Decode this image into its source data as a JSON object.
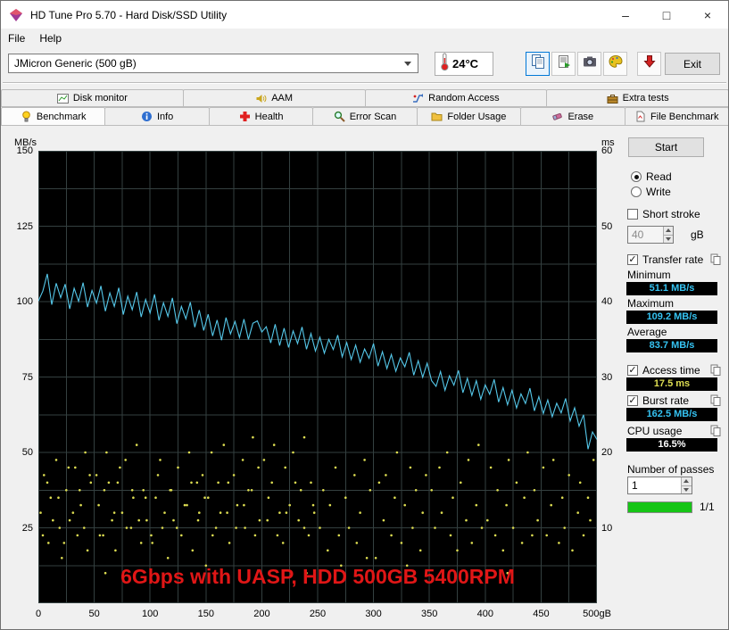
{
  "window": {
    "title": "HD Tune Pro 5.70 - Hard Disk/SSD Utility",
    "controls": {
      "minimize": "–",
      "maximize": "□",
      "close": "×"
    }
  },
  "menu": {
    "file": "File",
    "help": "Help"
  },
  "toolbar": {
    "drive_select": "JMicron Generic (500 gB)",
    "temperature": "24°C",
    "exit_label": "Exit"
  },
  "tabs": {
    "row1": [
      "Disk monitor",
      "AAM",
      "Random Access",
      "Extra tests"
    ],
    "row2": [
      "Benchmark",
      "Info",
      "Health",
      "Error Scan",
      "Folder Usage",
      "Erase",
      "File Benchmark"
    ],
    "active": "Benchmark"
  },
  "panel": {
    "start_label": "Start",
    "read_label": "Read",
    "write_label": "Write",
    "short_stroke_label": "Short stroke",
    "short_stroke_value": "40",
    "short_stroke_unit": "gB",
    "transfer_rate_label": "Transfer rate",
    "minimum_label": "Minimum",
    "minimum_value": "51.1 MB/s",
    "maximum_label": "Maximum",
    "maximum_value": "109.2 MB/s",
    "average_label": "Average",
    "average_value": "83.7 MB/s",
    "access_time_label": "Access time",
    "access_time_value": "17.5 ms",
    "burst_rate_label": "Burst rate",
    "burst_rate_value": "162.5 MB/s",
    "cpu_usage_label": "CPU usage",
    "cpu_usage_value": "16.5%",
    "passes_label": "Number of passes",
    "passes_value": "1",
    "progress_label": "1/1"
  },
  "icons": {
    "checkmark": "✓"
  },
  "chart_data": {
    "type": "line",
    "x_unit": "gB",
    "x_range": [
      0,
      500
    ],
    "x_ticks": [
      0,
      50,
      100,
      150,
      200,
      250,
      300,
      350,
      400,
      450,
      500
    ],
    "x_tick_labels": [
      "0",
      "50",
      "100",
      "150",
      "200",
      "250",
      "300",
      "350",
      "400",
      "450",
      "500gB"
    ],
    "y_left": {
      "unit": "MB/s",
      "range": [
        0,
        150
      ],
      "ticks": [
        150,
        125,
        100,
        75,
        50,
        25
      ]
    },
    "y_right": {
      "unit": "ms",
      "range": [
        0,
        60
      ],
      "ticks": [
        60,
        50,
        40,
        30,
        20,
        10
      ]
    },
    "grid": {
      "color": "#344040",
      "x_step": 25,
      "y_step": 12.5
    },
    "stats": {
      "minimum_mbs": 51.1,
      "maximum_mbs": 109.2,
      "average_mbs": 83.7,
      "access_time_ms": 17.5,
      "burst_rate_mbs": 162.5,
      "cpu_usage_pct": 16.5
    },
    "annotation": {
      "text": "6Gbps with UASP, HDD 500GB 5400RPM",
      "color": "#e01616"
    },
    "series": [
      {
        "name": "transfer_rate",
        "type": "line",
        "color": "#55c8ea",
        "axis": "left",
        "x_start": 0,
        "x_step": 4,
        "values": [
          100.2,
          103.5,
          109.2,
          99.0,
          106.1,
          101.3,
          105.8,
          97.6,
          104.4,
          100.1,
          106.3,
          98.2,
          103.7,
          99.5,
          105.2,
          96.8,
          102.9,
          98.4,
          104.6,
          95.7,
          101.8,
          97.3,
          103.2,
          94.9,
          100.7,
          96.2,
          102.4,
          93.8,
          99.6,
          95.1,
          101.2,
          92.7,
          98.4,
          94.3,
          99.8,
          91.5,
          97.2,
          90.4,
          95.8,
          88.6,
          93.9,
          87.2,
          94.7,
          89.3,
          93.4,
          88.1,
          94.2,
          87.5,
          92.8,
          93.6,
          89.9,
          91.7,
          86.3,
          92.5,
          85.4,
          91.2,
          84.8,
          90.3,
          86.1,
          91.6,
          84.2,
          89.4,
          83.6,
          88.2,
          82.9,
          87.5,
          84.1,
          88.9,
          81.7,
          86.4,
          80.8,
          85.6,
          79.9,
          84.3,
          81.2,
          86.1,
          78.6,
          83.4,
          77.8,
          82.5,
          76.9,
          81.3,
          78.4,
          83.2,
          75.6,
          80.4,
          74.9,
          79.6,
          73.8,
          71.9,
          76.8,
          70.6,
          75.4,
          72.3,
          77.2,
          69.8,
          74.6,
          68.9,
          73.8,
          67.6,
          72.4,
          69.3,
          74.2,
          66.7,
          71.5,
          65.8,
          70.6,
          64.7,
          69.4,
          66.2,
          71.3,
          63.8,
          68.5,
          62.9,
          67.4,
          61.8,
          66.3,
          63.1,
          67.9,
          60.4,
          64.8,
          58.7,
          62.5,
          51.1,
          56.8,
          54.3
        ]
      },
      {
        "name": "access_time",
        "type": "scatter",
        "color": "#dede52",
        "axis": "right",
        "points": [
          [
            2,
            12
          ],
          [
            5,
            17
          ],
          [
            9,
            8
          ],
          [
            11,
            14
          ],
          [
            16,
            19
          ],
          [
            19,
            10
          ],
          [
            21,
            6
          ],
          [
            25,
            15
          ],
          [
            28,
            11
          ],
          [
            33,
            18
          ],
          [
            35,
            9
          ],
          [
            38,
            13
          ],
          [
            42,
            20
          ],
          [
            44,
            7
          ],
          [
            47,
            16
          ],
          [
            52,
            17
          ],
          [
            55,
            9
          ],
          [
            59,
            15
          ],
          [
            61,
            20
          ],
          [
            66,
            11
          ],
          [
            69,
            7
          ],
          [
            71,
            16
          ],
          [
            75,
            12
          ],
          [
            78,
            19
          ],
          [
            83,
            10
          ],
          [
            85,
            14
          ],
          [
            88,
            21
          ],
          [
            92,
            8
          ],
          [
            94,
            15
          ],
          [
            97,
            11
          ],
          [
            102,
            8
          ],
          [
            105,
            14
          ],
          [
            109,
            19
          ],
          [
            111,
            10
          ],
          [
            116,
            6
          ],
          [
            119,
            15
          ],
          [
            121,
            11
          ],
          [
            125,
            18
          ],
          [
            128,
            9
          ],
          [
            133,
            13
          ],
          [
            135,
            20
          ],
          [
            138,
            7
          ],
          [
            142,
            16
          ],
          [
            144,
            12
          ],
          [
            147,
            17
          ],
          [
            152,
            14
          ],
          [
            155,
            20
          ],
          [
            159,
            10
          ],
          [
            161,
            16
          ],
          [
            166,
            21
          ],
          [
            169,
            12
          ],
          [
            171,
            8
          ],
          [
            175,
            17
          ],
          [
            178,
            13
          ],
          [
            183,
            19
          ],
          [
            185,
            10
          ],
          [
            188,
            15
          ],
          [
            192,
            22
          ],
          [
            194,
            9
          ],
          [
            197,
            18
          ],
          [
            202,
            19
          ],
          [
            205,
            11
          ],
          [
            209,
            16
          ],
          [
            211,
            21
          ],
          [
            216,
            12
          ],
          [
            219,
            8
          ],
          [
            221,
            18
          ],
          [
            225,
            13
          ],
          [
            228,
            20
          ],
          [
            233,
            11
          ],
          [
            235,
            15
          ],
          [
            238,
            22
          ],
          [
            242,
            9
          ],
          [
            244,
            16
          ],
          [
            247,
            12
          ],
          [
            252,
            10
          ],
          [
            255,
            15
          ],
          [
            259,
            7
          ],
          [
            261,
            13
          ],
          [
            266,
            18
          ],
          [
            269,
            9
          ],
          [
            271,
            5
          ],
          [
            275,
            14
          ],
          [
            278,
            10
          ],
          [
            283,
            17
          ],
          [
            285,
            8
          ],
          [
            288,
            12
          ],
          [
            292,
            19
          ],
          [
            294,
            6
          ],
          [
            297,
            15
          ],
          [
            302,
            6
          ],
          [
            305,
            16
          ],
          [
            309,
            11
          ],
          [
            311,
            17
          ],
          [
            316,
            9
          ],
          [
            319,
            14
          ],
          [
            321,
            20
          ],
          [
            325,
            8
          ],
          [
            328,
            13
          ],
          [
            333,
            18
          ],
          [
            335,
            10
          ],
          [
            338,
            15
          ],
          [
            342,
            7
          ],
          [
            344,
            12
          ],
          [
            347,
            17
          ],
          [
            352,
            15
          ],
          [
            355,
            10
          ],
          [
            359,
            18
          ],
          [
            361,
            12
          ],
          [
            366,
            20
          ],
          [
            369,
            9
          ],
          [
            371,
            14
          ],
          [
            375,
            7
          ],
          [
            378,
            16
          ],
          [
            383,
            11
          ],
          [
            385,
            19
          ],
          [
            388,
            8
          ],
          [
            392,
            13
          ],
          [
            394,
            21
          ],
          [
            397,
            10
          ],
          [
            402,
            11
          ],
          [
            405,
            18
          ],
          [
            409,
            9
          ],
          [
            411,
            15
          ],
          [
            416,
            7
          ],
          [
            419,
            13
          ],
          [
            421,
            19
          ],
          [
            425,
            10
          ],
          [
            428,
            16
          ],
          [
            433,
            8
          ],
          [
            435,
            14
          ],
          [
            438,
            20
          ],
          [
            442,
            9
          ],
          [
            444,
            15
          ],
          [
            447,
            11
          ],
          [
            452,
            18
          ],
          [
            455,
            9
          ],
          [
            459,
            13
          ],
          [
            461,
            19
          ],
          [
            466,
            8
          ],
          [
            469,
            14
          ],
          [
            471,
            10
          ],
          [
            475,
            17
          ],
          [
            478,
            7
          ],
          [
            483,
            12
          ],
          [
            485,
            16
          ],
          [
            488,
            9
          ],
          [
            492,
            14
          ],
          [
            494,
            11
          ],
          [
            497,
            19
          ],
          [
            4,
            9
          ],
          [
            8,
            16
          ],
          [
            13,
            11
          ],
          [
            18,
            14
          ],
          [
            23,
            8
          ],
          [
            27,
            18
          ],
          [
            31,
            12
          ],
          [
            37,
            15
          ],
          [
            41,
            10
          ],
          [
            46,
            17
          ],
          [
            54,
            13
          ],
          [
            58,
            9
          ],
          [
            63,
            16
          ],
          [
            68,
            12
          ],
          [
            73,
            18
          ],
          [
            79,
            10
          ],
          [
            84,
            15
          ],
          [
            90,
            11
          ],
          [
            96,
            14
          ],
          [
            101,
            9
          ],
          [
            107,
            17
          ],
          [
            113,
            12
          ],
          [
            118,
            15
          ],
          [
            124,
            10
          ],
          [
            131,
            13
          ],
          [
            137,
            16
          ],
          [
            143,
            11
          ],
          [
            149,
            14
          ],
          [
            156,
            9
          ],
          [
            163,
            12
          ],
          [
            170,
            16
          ],
          [
            177,
            10
          ],
          [
            184,
            13
          ],
          [
            191,
            15
          ],
          [
            198,
            11
          ],
          [
            206,
            14
          ],
          [
            214,
            9
          ],
          [
            222,
            12
          ],
          [
            230,
            16
          ],
          [
            238,
            10
          ],
          [
            246,
            13
          ],
          [
            60,
            4
          ],
          [
            150,
            5
          ],
          [
            240,
            4
          ],
          [
            330,
            5
          ],
          [
            420,
            4
          ]
        ]
      }
    ]
  }
}
